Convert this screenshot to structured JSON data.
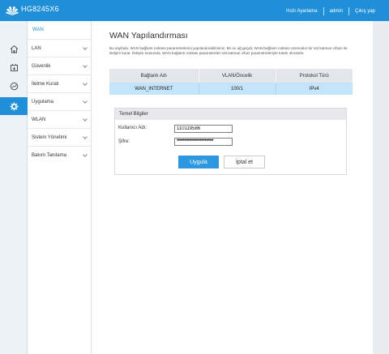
{
  "header": {
    "model": "HG8245X6",
    "links": [
      "Hızlı Ayarlama",
      "admin",
      "Çıkış yap"
    ],
    "brand_color": "#1f8fd8"
  },
  "icon_rail": {
    "items": [
      {
        "icon": "home-icon",
        "active": false
      },
      {
        "icon": "network-box-icon",
        "active": false
      },
      {
        "icon": "gauge-icon",
        "active": false
      },
      {
        "icon": "gear-icon",
        "active": true
      }
    ]
  },
  "sidebar": {
    "header": "WAN",
    "items": [
      {
        "label": "LAN"
      },
      {
        "label": "Güvenlik"
      },
      {
        "label": "İletme Kuralı"
      },
      {
        "label": "Uygulama"
      },
      {
        "label": "WLAN"
      },
      {
        "label": "Sistem Yönetimi"
      },
      {
        "label": "Bakım Tanılama"
      }
    ]
  },
  "main": {
    "title": "WAN Yapılandırması",
    "description": "Bu sayfada, WAN bağlantı noktası parametrelerini yapılandırabilirsiniz. Bir ev ağ geçidi, WAN bağlantı noktası üzerinden bir üst katman cihazı ile iletişim kurar. İletişim sırasında, WAN bağlantı noktası parametreleri üst katman cihaz parametreleriyle tutarlı olmalıdır.",
    "table": {
      "headers": [
        "Bağlantı Adı",
        "VLAN/Öncelik",
        "Protokol Türü"
      ],
      "rows": [
        [
          "WAN_INTERNET",
          "100/1",
          "IPv4"
        ]
      ]
    },
    "basic": {
      "title": "Temel Bilgiler",
      "username_label": "Kullanıcı Adı:",
      "username_value": "110119586",
      "password_label": "Şifre:",
      "password_mask": "••••••••••••••••••••••••••••••"
    },
    "buttons": {
      "apply": "Uygula",
      "cancel": "İptal et"
    }
  }
}
